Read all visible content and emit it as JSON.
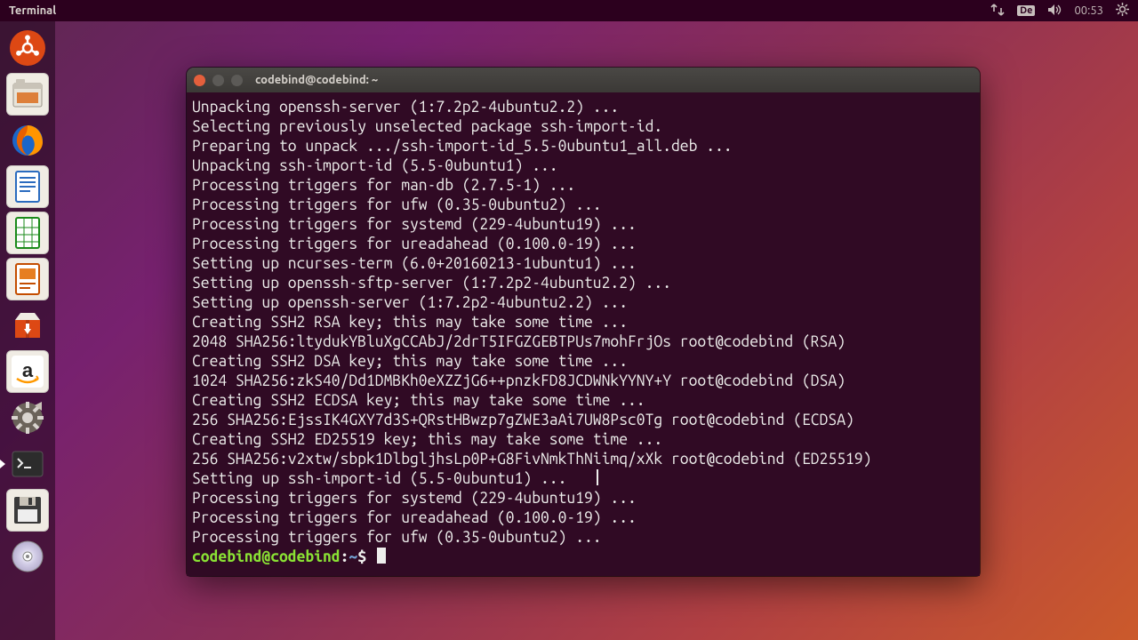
{
  "panel": {
    "app": "Terminal",
    "keyboard": "De",
    "time": "00:53"
  },
  "launcher": [
    {
      "name": "ubuntu-dash",
      "type": "dash"
    },
    {
      "name": "files",
      "type": "files"
    },
    {
      "name": "firefox",
      "type": "firefox"
    },
    {
      "name": "writer",
      "type": "writer"
    },
    {
      "name": "calc",
      "type": "calc"
    },
    {
      "name": "impress",
      "type": "impress"
    },
    {
      "name": "software",
      "type": "software"
    },
    {
      "name": "amazon",
      "type": "amazon"
    },
    {
      "name": "settings",
      "type": "settings"
    },
    {
      "name": "terminal",
      "type": "terminal",
      "active": true
    },
    {
      "name": "floppy",
      "type": "floppy"
    },
    {
      "name": "disc",
      "type": "disc"
    }
  ],
  "window": {
    "title": "codebind@codebind: ~",
    "prompt": {
      "user": "codebind@codebind",
      "sep": ":",
      "path": "~",
      "sym": "$"
    },
    "lines": [
      "Unpacking openssh-server (1:7.2p2-4ubuntu2.2) ...",
      "Selecting previously unselected package ssh-import-id.",
      "Preparing to unpack .../ssh-import-id_5.5-0ubuntu1_all.deb ...",
      "Unpacking ssh-import-id (5.5-0ubuntu1) ...",
      "Processing triggers for man-db (2.7.5-1) ...",
      "Processing triggers for ufw (0.35-0ubuntu2) ...",
      "Processing triggers for systemd (229-4ubuntu19) ...",
      "Processing triggers for ureadahead (0.100.0-19) ...",
      "Setting up ncurses-term (6.0+20160213-1ubuntu1) ...",
      "Setting up openssh-sftp-server (1:7.2p2-4ubuntu2.2) ...",
      "Setting up openssh-server (1:7.2p2-4ubuntu2.2) ...",
      "Creating SSH2 RSA key; this may take some time ...",
      "2048 SHA256:ltydukYBluXgCCAbJ/2drT5IFGZGEBTPUs7mohFrjOs root@codebind (RSA)",
      "Creating SSH2 DSA key; this may take some time ...",
      "1024 SHA256:zkS40/Dd1DMBKh0eXZZjG6++pnzkFD8JCDWNkYYNY+Y root@codebind (DSA)",
      "Creating SSH2 ECDSA key; this may take some time ...",
      "256 SHA256:EjssIK4GXY7d3S+QRstHBwzp7gZWE3aAi7UW8Psc0Tg root@codebind (ECDSA)",
      "Creating SSH2 ED25519 key; this may take some time ...",
      "256 SHA256:v2xtw/sbpk1DlbgljhsLp0P+G8FivNmkThNiimq/xXk root@codebind (ED25519)",
      "Setting up ssh-import-id (5.5-0ubuntu1) ...",
      "Processing triggers for systemd (229-4ubuntu19) ...",
      "Processing triggers for ureadahead (0.100.0-19) ...",
      "Processing triggers for ufw (0.35-0ubuntu2) ..."
    ]
  }
}
